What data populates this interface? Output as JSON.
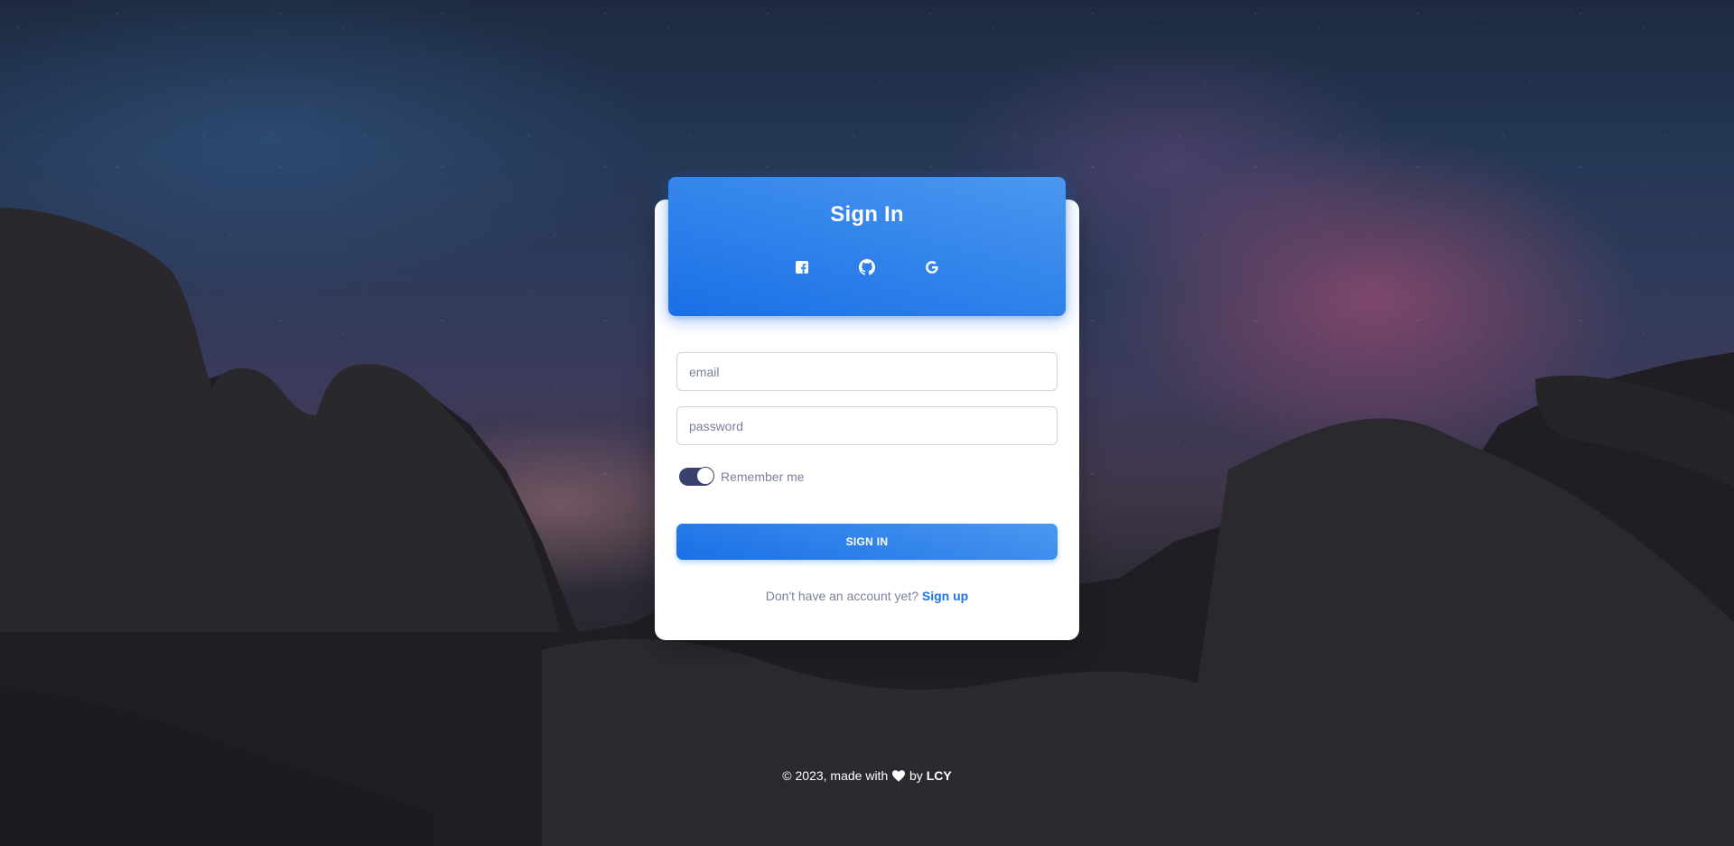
{
  "header": {
    "title": "Sign In",
    "social": [
      {
        "icon": "facebook-icon"
      },
      {
        "icon": "github-icon"
      },
      {
        "icon": "google-icon"
      }
    ]
  },
  "form": {
    "email_placeholder": "email",
    "email_value": "",
    "password_placeholder": "password",
    "password_value": "",
    "remember_label": "Remember me",
    "remember_checked": true,
    "submit_label": "SIGN IN"
  },
  "signup": {
    "prompt": "Don't have an account yet?",
    "link": "Sign up"
  },
  "footer": {
    "prefix": "© 2023, made with",
    "by": "by",
    "author": "LCY"
  },
  "colors": {
    "accent": "#1a73e8",
    "toggle": "#3a416f",
    "muted_text": "#7b809a"
  }
}
